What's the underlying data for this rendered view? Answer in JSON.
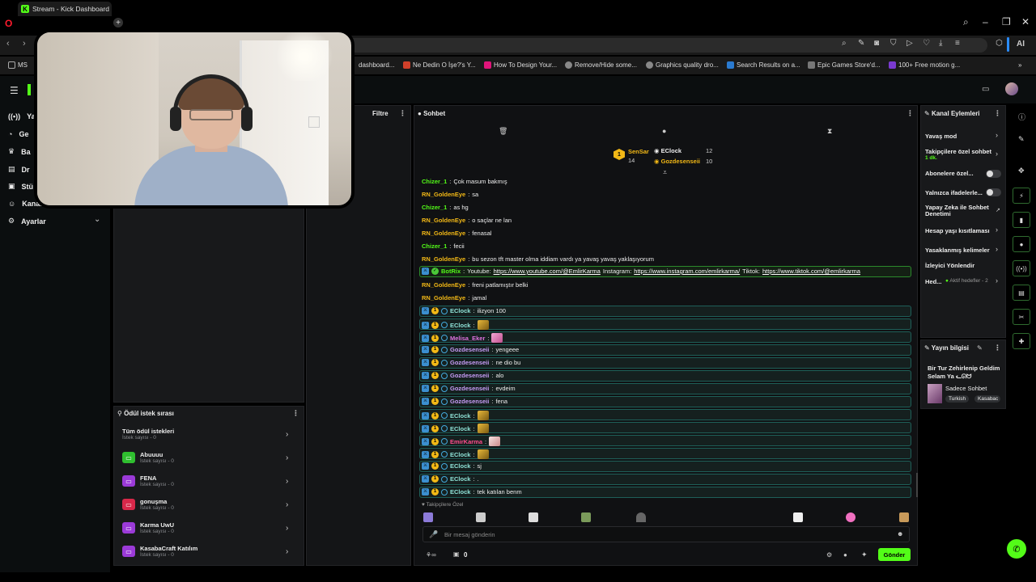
{
  "browser": {
    "tab_title": "Stream - Kick Dashboard",
    "new_tab": "+",
    "ai_label": "AI",
    "bookmarks": [
      {
        "label": "MS",
        "color": "#666666"
      },
      {
        "label": "dashboard...",
        "color": "#1a1a1a"
      },
      {
        "label": "Ne Dedin O İşe?'s Y...",
        "color": "#d0402a"
      },
      {
        "label": "How To Design Your...",
        "color": "#e0147a"
      },
      {
        "label": "Remove/Hide some...",
        "color": "#888888"
      },
      {
        "label": "Graphics quality dro...",
        "color": "#888888"
      },
      {
        "label": "Search Results on a...",
        "color": "#2a7ad0"
      },
      {
        "label": "Epic Games Store'd...",
        "color": "#777777"
      },
      {
        "label": "100+ Free motion g...",
        "color": "#7a3ad0"
      }
    ]
  },
  "sidebar": {
    "items": [
      {
        "label": "Ya",
        "icon": "broadcast-icon"
      },
      {
        "label": "Ge",
        "icon": "gauge-icon"
      },
      {
        "label": "Ba",
        "icon": "trophy-icon"
      },
      {
        "label": "Dr",
        "icon": "drops-icon"
      },
      {
        "label": "Stü",
        "icon": "studio-icon"
      },
      {
        "label": "Kanal",
        "icon": "user-icon"
      },
      {
        "label": "Ayarlar",
        "icon": "gear-icon"
      }
    ]
  },
  "filter_panel": {
    "title": "Filtre"
  },
  "chat": {
    "title": "Sohbet",
    "leaderboard": [
      {
        "rank": "1",
        "name": "SenSar",
        "value": "14"
      },
      {
        "rank": "",
        "name": "EClock",
        "value": "12"
      },
      {
        "rank": "",
        "name": "Gozdesenseii",
        "value": "10"
      }
    ],
    "messages": [
      {
        "user": "Chizer_1",
        "color": "#53fc18",
        "text": "Çok masum bakmış"
      },
      {
        "user": "RN_GoldenEye",
        "color": "#f2b816",
        "text": "sa"
      },
      {
        "user": "Chizer_1",
        "color": "#53fc18",
        "text": "as hg"
      },
      {
        "user": "RN_GoldenEye",
        "color": "#f2b816",
        "text": "o saçlar ne lan"
      },
      {
        "user": "RN_GoldenEye",
        "color": "#f2b816",
        "text": "fenasal"
      },
      {
        "user": "Chizer_1",
        "color": "#53fc18",
        "text": "fecii"
      },
      {
        "user": "RN_GoldenEye",
        "color": "#f2b816",
        "text": "bu sezon tft master olma iddiam vardı ya yavaş yavaş yaklaşıyorum"
      }
    ],
    "bot": {
      "user": "BotRix",
      "yt_label": "Youtube:",
      "yt_url": "https://www.youtube.com/@EmlirKarma",
      "ig_label": "Instagram:",
      "ig_url": "https://www.instagram.com/emlirkarma/",
      "tt_label": "Tiktok:",
      "tt_url": "https://www.tiktok.com/@emlirkarma"
    },
    "messages2": [
      {
        "user": "RN_GoldenEye",
        "color": "#f2b816",
        "text": "freni patlamıştır belki"
      },
      {
        "user": "RN_GoldenEye",
        "color": "#f2b816",
        "text": "jamal"
      }
    ],
    "sub_messages": [
      {
        "user": "EClock",
        "color": "#8fe3d8",
        "text": "ilizyon 100",
        "emote": ""
      },
      {
        "user": "EClock",
        "color": "#8fe3d8",
        "text": "",
        "emote": "gold"
      },
      {
        "user": "Melisa_Eker",
        "color": "#e072e0",
        "text": "",
        "emote": "pink"
      },
      {
        "user": "Gozdesenseii",
        "color": "#c89cf8",
        "text": "yengeee",
        "emote": ""
      },
      {
        "user": "Gozdesenseii",
        "color": "#c89cf8",
        "text": "ne dio bu",
        "emote": ""
      },
      {
        "user": "Gozdesenseii",
        "color": "#c89cf8",
        "text": "alo",
        "emote": ""
      },
      {
        "user": "Gozdesenseii",
        "color": "#c89cf8",
        "text": "evdeim",
        "emote": ""
      },
      {
        "user": "Gozdesenseii",
        "color": "#c89cf8",
        "text": "fena",
        "emote": ""
      },
      {
        "user": "EClock",
        "color": "#8fe3d8",
        "text": "",
        "emote": "gold"
      },
      {
        "user": "EClock",
        "color": "#8fe3d8",
        "text": "",
        "emote": "gold"
      },
      {
        "user": "EmirKarma",
        "color": "#ff4d8d",
        "text": "",
        "emote": "white"
      },
      {
        "user": "EClock",
        "color": "#8fe3d8",
        "text": "",
        "emote": "gold"
      },
      {
        "user": "EClock",
        "color": "#8fe3d8",
        "text": "sj",
        "emote": ""
      },
      {
        "user": "EClock",
        "color": "#8fe3d8",
        "text": ".",
        "emote": ""
      },
      {
        "user": "EClock",
        "color": "#8fe3d8",
        "text": "tek katılan benm",
        "emote": ""
      }
    ],
    "followers_only_label": "Takipçilere Özel",
    "input_placeholder": "Bir mesaj gönderin",
    "points": "0",
    "send_label": "Gönder"
  },
  "reward_queue": {
    "title": "Ödül istek sırası",
    "all_label": "Tüm ödül istekleri",
    "all_count": "İstek sayısı - 0",
    "items": [
      {
        "name": "Abuuuu",
        "count": "İstek sayısı - 0",
        "color": "#2fbf2f"
      },
      {
        "name": "FENA",
        "count": "İstek sayısı - 0",
        "color": "#9b3ad8"
      },
      {
        "name": "gonuşma",
        "count": "İstek sayısı - 0",
        "color": "#d8284a"
      },
      {
        "name": "Karma UwU",
        "count": "İstek sayısı - 0",
        "color": "#9b3ad8"
      },
      {
        "name": "KasabaCraft Katılım",
        "count": "İstek sayısı - 0",
        "color": "#9b3ad8"
      }
    ]
  },
  "channel_actions": {
    "title": "Kanal Eylemleri",
    "items": [
      {
        "label": "Yavaş mod",
        "sub": "",
        "control": "chevron"
      },
      {
        "label": "Takipçilere özel sohbet",
        "sub": "1 dk.",
        "control": "chevron"
      },
      {
        "label": "Abonelere özel...",
        "sub": "",
        "control": "toggle"
      },
      {
        "label": "Yalnızca ifadelerle...",
        "sub": "",
        "control": "toggle"
      },
      {
        "label": "Yapay Zeka ile Sohbet Denetimi",
        "sub": "",
        "control": "external"
      },
      {
        "label": "Hesap yaşı kısıtlaması",
        "sub": "",
        "control": "chevron"
      },
      {
        "label": "Yasaklanmış kelimeler",
        "sub": "",
        "control": "chevron"
      },
      {
        "label": "İzleyici Yönlendir",
        "sub": "",
        "control": "none"
      },
      {
        "label": "Hed...",
        "sub": "Aktif hedefler - 2",
        "control": "chevron"
      }
    ]
  },
  "stream_info": {
    "title": "Yayın bilgisi",
    "stream_title": "Bir Tur Zehirlenip Geldim Selam Ya ᓚᘏᗢ",
    "category": "Sadece Sohbet",
    "tags": [
      "Turkish",
      "Kasabac"
    ]
  }
}
